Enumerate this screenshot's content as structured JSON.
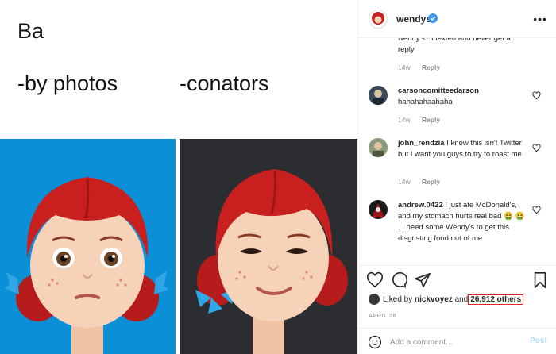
{
  "post": {
    "meme_text": {
      "top": "Ba",
      "left_caption": "-by photos",
      "right_caption": "-conators"
    },
    "panel_colors": {
      "left": "#0b8fd6",
      "right": "#2c2d31",
      "hair": "#c8201f"
    }
  },
  "header": {
    "username": "wendys",
    "verified": true,
    "more_icon": "more-horizontal-icon"
  },
  "comments": [
    {
      "user": "",
      "text": "wendy's? I texted and never get a reply",
      "age": "14w",
      "reply_label": "Reply"
    },
    {
      "user": "carsoncomitteedarson",
      "text": "hahahahaahaha",
      "age": "14w",
      "reply_label": "Reply"
    },
    {
      "user": "john_rendzia",
      "text": "I know this isn't Twitter but I want you guys to try to roast me",
      "age": "14w",
      "reply_label": "Reply"
    },
    {
      "user": "andrew.0422",
      "text": "I just ate McDonald's, and my stomach hurts real bad 🤮 🤮 . I need some Wendy's to get this disgusting food out of me",
      "age": "",
      "reply_label": ""
    }
  ],
  "actions": {
    "icons": [
      "heart-icon",
      "comment-icon",
      "share-icon",
      "bookmark-icon"
    ],
    "likes_prefix": "Liked by",
    "likes_user": "nickvoyez",
    "likes_and": "and",
    "likes_others": "26,912 others",
    "highlight_color": "#e01f26",
    "date": "APRIL 28"
  },
  "add_comment": {
    "placeholder": "Add a comment...",
    "post_label": "Post"
  }
}
